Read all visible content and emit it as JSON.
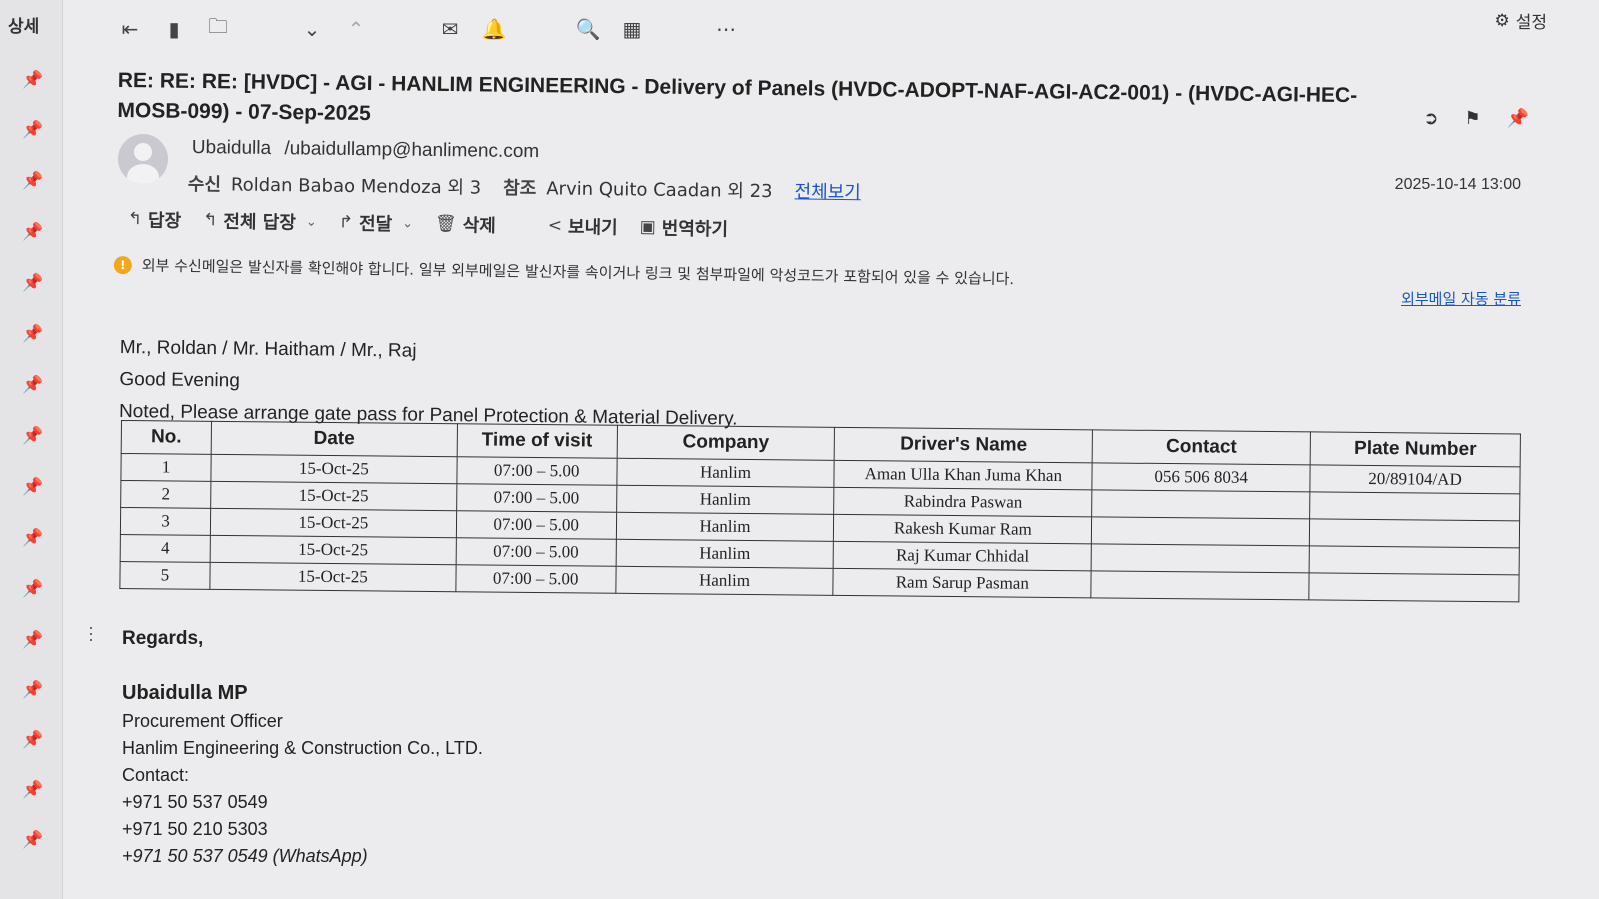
{
  "rail": {
    "detail_label": "상세",
    "pins": [
      "pin-icon",
      "pin-icon",
      "pin-icon",
      "pin-icon",
      "pin-icon",
      "pin-icon",
      "pin-icon",
      "pin-icon",
      "pin-icon",
      "pin-icon",
      "pin-icon",
      "pin-icon",
      "pin-icon",
      "pin-icon",
      "pin-icon",
      "pin-icon"
    ]
  },
  "toolbar": {
    "icons": [
      "back-to-list-icon",
      "copy-icon",
      "move-folder-icon",
      "chevron-down-icon",
      "chevron-up-icon",
      "mail-icon",
      "bell-icon",
      "zoom-icon",
      "calendar-icon",
      "more-icon"
    ],
    "settings_label": "설정"
  },
  "mail": {
    "subject": "RE: RE: RE: [HVDC] - AGI - HANLIM ENGINEERING - Delivery of Panels (HVDC-ADOPT-NAF-AGI-AC2-001) - (HVDC-AGI-HEC-MOSB-099) - 07-Sep-2025",
    "sender_name": "Ubaidulla",
    "sender_email": "/ubaidullamp@hanlimenc.com",
    "to_label": "수신",
    "to_value": "Roldan Babao Mendoza 외 3",
    "cc_label": "참조",
    "cc_value": "Arvin Quito Caadan 외 23",
    "view_all": "전체보기",
    "date": "2025-10-14 13:00"
  },
  "actions": {
    "reply": "답장",
    "reply_all": "전체 답장",
    "forward": "전달",
    "delete": "삭제",
    "share": "보내기",
    "translate": "번역하기"
  },
  "warning": {
    "text": "외부 수신메일은 발신자를 확인해야 합니다. 일부 외부메일은 발신자를 속이거나 링크 및 첨부파일에 악성코드가 포함되어 있을 수 있습니다.",
    "auto_classify": "외부메일 자동 분류"
  },
  "body": {
    "greeting_names": "Mr., Roldan / Mr. Haitham / Mr., Raj",
    "greeting": "Good Evening",
    "message": "Noted, Please arrange gate pass for Panel Protection & Material Delivery."
  },
  "table": {
    "headers": [
      "No.",
      "Date",
      "Time of visit",
      "Company",
      "Driver's Name",
      "Contact",
      "Plate Number"
    ],
    "rows": [
      [
        "1",
        "15-Oct-25",
        "07:00 – 5.00",
        "Hanlim",
        "Aman Ulla Khan Juma Khan",
        "056 506 8034",
        "20/89104/AD"
      ],
      [
        "2",
        "15-Oct-25",
        "07:00 – 5.00",
        "Hanlim",
        "Rabindra Paswan",
        "",
        ""
      ],
      [
        "3",
        "15-Oct-25",
        "07:00 – 5.00",
        "Hanlim",
        "Rakesh Kumar Ram",
        "",
        ""
      ],
      [
        "4",
        "15-Oct-25",
        "07:00 – 5.00",
        "Hanlim",
        "Raj Kumar Chhidal",
        "",
        ""
      ],
      [
        "5",
        "15-Oct-25",
        "07:00 – 5.00",
        "Hanlim",
        "Ram Sarup Pasman",
        "",
        ""
      ]
    ]
  },
  "signature": {
    "regards": "Regards,",
    "name": "Ubaidulla MP",
    "title": "Procurement Officer",
    "company": "Hanlim Engineering & Construction Co., LTD.",
    "contact_label": "Contact:",
    "phone1": "+971 50 537 0549",
    "phone2": "+971 50 210 5303",
    "phone3": "+971 50 537 0549 (WhatsApp)"
  }
}
